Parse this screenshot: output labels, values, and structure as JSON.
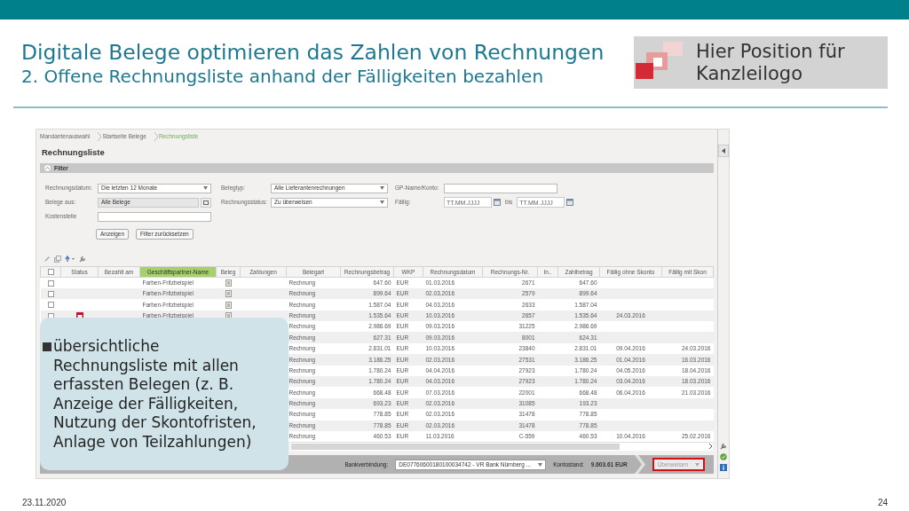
{
  "slide": {
    "title": "Digitale Belege optimieren das Zahlen von Rechnungen",
    "subtitle": "2. Offene Rechnungsliste anhand der Fälligkeiten bezahlen",
    "logo_text": "Hier Position für Kanzleilogo",
    "date": "23.11.2020",
    "page": "24"
  },
  "app": {
    "breadcrumb": [
      {
        "label": "Mandantenauswahl",
        "selected": false
      },
      {
        "label": "Startseite Belege",
        "selected": false
      },
      {
        "label": "Rechnungsliste",
        "selected": true
      }
    ],
    "title": "Rechnungsliste",
    "filter": {
      "title": "Filter",
      "expanded": true,
      "rows": [
        [
          {
            "label": "Rechnungsdatum:",
            "kind": "select",
            "value": "Die letzten 12 Monate"
          },
          {
            "label": "Belegtyp:",
            "kind": "select",
            "value": "Alle Lieferantenrechnungen"
          },
          {
            "label": "GP-Name/Konto:",
            "kind": "text"
          }
        ],
        [
          {
            "label": "Belege aus:",
            "kind": "picker",
            "value": "Alle Belege"
          },
          {
            "label": "Rechnungsstatus:",
            "kind": "select",
            "value": "Zu überweisen"
          },
          {
            "label": "Fällig:",
            "kind": "daterange",
            "placeholder": "TT.MM.JJJJ",
            "separator": "bis",
            "placeholder_to": "TT.MM.JJJJ"
          }
        ],
        [
          {
            "label": "Kostenstelle",
            "kind": "text"
          }
        ]
      ],
      "buttons": [
        "Anzeigen",
        "Filter zurücksetzen"
      ]
    },
    "table": {
      "header_checked": false,
      "columns": [
        {
          "label": "Status",
          "sorted": false
        },
        {
          "label": "Bezahlt am",
          "sorted": false
        },
        {
          "label": "Geschäftspartner-Name",
          "sorted": true
        },
        {
          "label": "Beleg",
          "sorted": false
        },
        {
          "label": "Zahlungen",
          "sorted": false
        },
        {
          "label": "Belegart",
          "sorted": false
        },
        {
          "label": "Rechnungsbetrag",
          "sorted": false
        },
        {
          "label": "WKP",
          "sorted": false
        },
        {
          "label": "Rechnungsdatum",
          "sorted": false
        },
        {
          "label": "Rechnungs-Nr.",
          "sorted": false
        },
        {
          "label": "In..",
          "sorted": false
        },
        {
          "label": "Zahlbetrag",
          "sorted": false
        },
        {
          "label": "Fällig ohne Skonto",
          "sorted": false
        },
        {
          "label": "Fällig mit Skon",
          "sorted": false
        }
      ],
      "rows": [
        {
          "checked": false,
          "status_flag": false,
          "partner": "Farben-Fritzbeispiel",
          "has_document": true,
          "type": "Rechnung",
          "amount": "647.60",
          "currency": "EUR",
          "date": "01.03.2016",
          "number": "2671",
          "pay": "647.60"
        },
        {
          "checked": false,
          "status_flag": false,
          "partner": "Farben-Fritzbeispiel",
          "has_document": true,
          "type": "Rechnung",
          "amount": "899.64",
          "currency": "EUR",
          "date": "02.03.2016",
          "number": "2579",
          "pay": "899.64"
        },
        {
          "checked": false,
          "status_flag": false,
          "partner": "Farben-Fritzbeispiel",
          "has_document": true,
          "type": "Rechnung",
          "amount": "1.587.04",
          "currency": "EUR",
          "date": "04.03.2016",
          "number": "2633",
          "pay": "1.587.04"
        },
        {
          "checked": false,
          "status_flag": true,
          "partner": "Farben-Fritzbeispiel",
          "has_document": true,
          "type": "Rechnung",
          "amount": "1.535.64",
          "currency": "EUR",
          "date": "10.03.2016",
          "number": "2657",
          "pay": "1.535.64",
          "due_net": "24.03.2016"
        },
        {
          "type": "Rechnung",
          "amount": "2.986.69",
          "currency": "EUR",
          "date": "09.03.2016",
          "number": "31225",
          "pay": "2.986.69"
        },
        {
          "type": "Rechnung",
          "amount": "627.31",
          "currency": "EUR",
          "date": "09.03.2016",
          "number": "8001",
          "pay": "624.31"
        },
        {
          "type": "Rechnung",
          "amount": "2.831.01",
          "currency": "EUR",
          "date": "10.03.2016",
          "number": "23840",
          "pay": "2.831.01",
          "due_net": "09.04.2016",
          "due_discount": "24.03.2016"
        },
        {
          "type": "Rechnung",
          "amount": "3.186.25",
          "currency": "EUR",
          "date": "02.03.2016",
          "number": "27531",
          "pay": "3.186.25",
          "due_net": "01.04.2016",
          "due_discount": "16.03.2016"
        },
        {
          "type": "Rechnung",
          "amount": "1.780.24",
          "currency": "EUR",
          "date": "04.04.2016",
          "number": "27923",
          "pay": "1.780.24",
          "due_net": "04.05.2016",
          "due_discount": "18.04.2016"
        },
        {
          "type": "Rechnung",
          "amount": "1.780.24",
          "currency": "EUR",
          "date": "04.03.2016",
          "number": "27923",
          "pay": "1.780.24",
          "due_net": "03.04.2016",
          "due_discount": "18.03.2016"
        },
        {
          "type": "Rechnung",
          "amount": "668.48",
          "currency": "EUR",
          "date": "07.03.2016",
          "number": "22001",
          "pay": "668.48",
          "due_net": "06.04.2016",
          "due_discount": "21.03.2016"
        },
        {
          "type": "Rechnung",
          "amount": "693.23",
          "currency": "EUR",
          "date": "02.03.2016",
          "number": "31085",
          "pay": "193.23"
        },
        {
          "type": "Rechnung",
          "amount": "778.85",
          "currency": "EUR",
          "date": "02.03.2016",
          "number": "31478",
          "pay": "778.85"
        },
        {
          "type": "Rechnung",
          "amount": "778.85",
          "currency": "EUR",
          "date": "02.03.2016",
          "number": "31478",
          "pay": "778.85"
        },
        {
          "type": "Rechnung",
          "amount": "460.53",
          "currency": "EUR",
          "date": "11.03.2016",
          "number": "C-559",
          "pay": "460.53",
          "due_net": "10.04.2016",
          "due_discount": "25.02.2016"
        }
      ]
    },
    "footer": {
      "bank_label": "Bankverbindung:",
      "bank_value": "DE07760600180100034742 - VR Bank Nürnberg ...",
      "balance_label": "Kontostand:",
      "balance_value": "9.603.61 EUR",
      "action": "Überweisen"
    }
  },
  "callout": "übersichtliche Rechnungsliste mit allen erfassten Belegen (z. B. Anzeige der Fälligkeiten, Nutzung der Skontofristen, Anlage von Teilzahlungen)"
}
